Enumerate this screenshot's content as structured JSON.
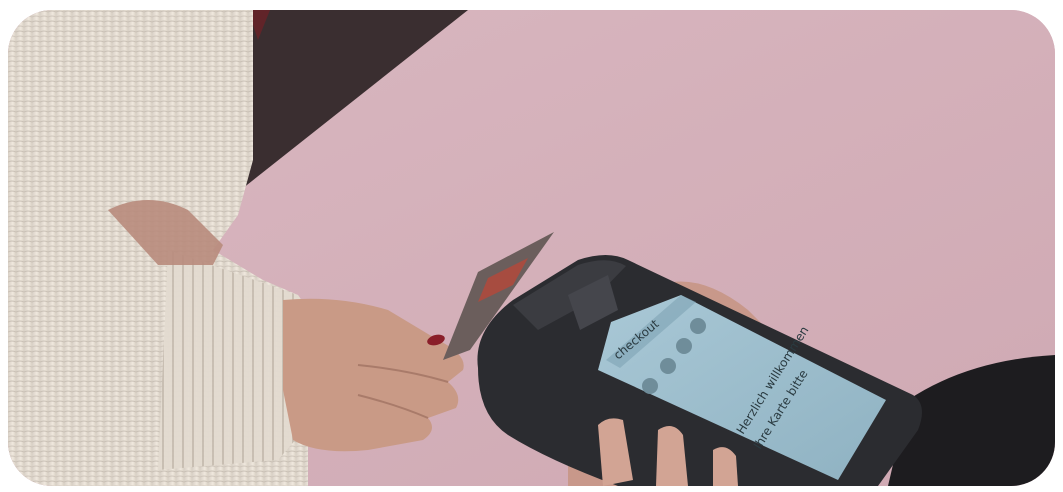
{
  "photo": {
    "subject": "contactless card payment at a handheld terminal",
    "terminal_screen": {
      "brand": "checkout",
      "line1": "Herzlich willkommen",
      "line2": "Ihre Karte bitte"
    },
    "colors": {
      "background": "#d7b3bc",
      "shadow_corner": "#3a2e30",
      "sweater": "#e8e0d6",
      "skin": "#c89a88",
      "terminal": "#2b2c30",
      "screen": "#9fc0cf",
      "sleeve_dark": "#1d1c1f"
    }
  }
}
